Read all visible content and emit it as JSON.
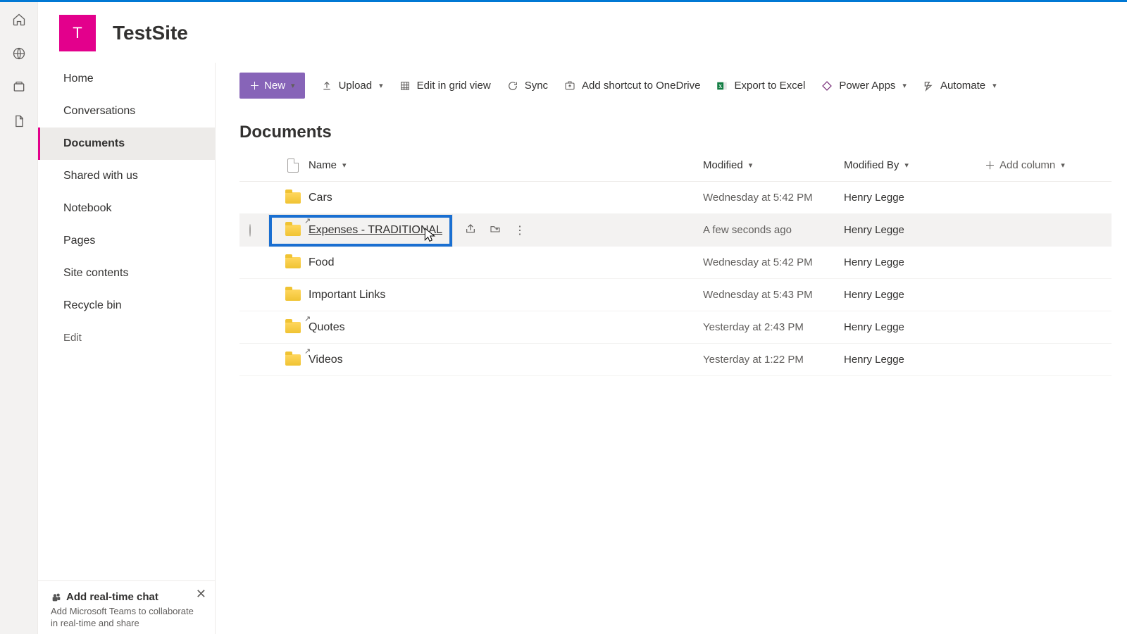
{
  "site": {
    "logo_letter": "T",
    "title": "TestSite"
  },
  "rail": {
    "items": [
      "home",
      "globe",
      "library",
      "page"
    ]
  },
  "sidebar": {
    "items": [
      {
        "label": "Home"
      },
      {
        "label": "Conversations"
      },
      {
        "label": "Documents",
        "selected": true
      },
      {
        "label": "Shared with us"
      },
      {
        "label": "Notebook"
      },
      {
        "label": "Pages"
      },
      {
        "label": "Site contents"
      },
      {
        "label": "Recycle bin"
      }
    ],
    "edit_label": "Edit",
    "promo": {
      "title": "Add real-time chat",
      "body": "Add Microsoft Teams to collaborate in real-time and share"
    }
  },
  "toolbar": {
    "new_label": "New",
    "upload_label": "Upload",
    "grid_label": "Edit in grid view",
    "sync_label": "Sync",
    "shortcut_label": "Add shortcut to OneDrive",
    "export_label": "Export to Excel",
    "powerapps_label": "Power Apps",
    "automate_label": "Automate"
  },
  "list": {
    "title": "Documents",
    "columns": {
      "name": "Name",
      "modified": "Modified",
      "modified_by": "Modified By",
      "add_column": "Add column"
    },
    "rows": [
      {
        "name": "Cars",
        "modified": "Wednesday at 5:42 PM",
        "by": "Henry Legge",
        "link": false,
        "hovered": false
      },
      {
        "name": "Expenses - TRADITIONAL",
        "modified": "A few seconds ago",
        "by": "Henry Legge",
        "link": true,
        "hovered": true
      },
      {
        "name": "Food",
        "modified": "Wednesday at 5:42 PM",
        "by": "Henry Legge",
        "link": false,
        "hovered": false
      },
      {
        "name": "Important Links",
        "modified": "Wednesday at 5:43 PM",
        "by": "Henry Legge",
        "link": false,
        "hovered": false
      },
      {
        "name": "Quotes",
        "modified": "Yesterday at 2:43 PM",
        "by": "Henry Legge",
        "link": true,
        "hovered": false
      },
      {
        "name": "Videos",
        "modified": "Yesterday at 1:22 PM",
        "by": "Henry Legge",
        "link": true,
        "hovered": false
      }
    ]
  },
  "annotation": {
    "highlight_row_index": 1
  }
}
